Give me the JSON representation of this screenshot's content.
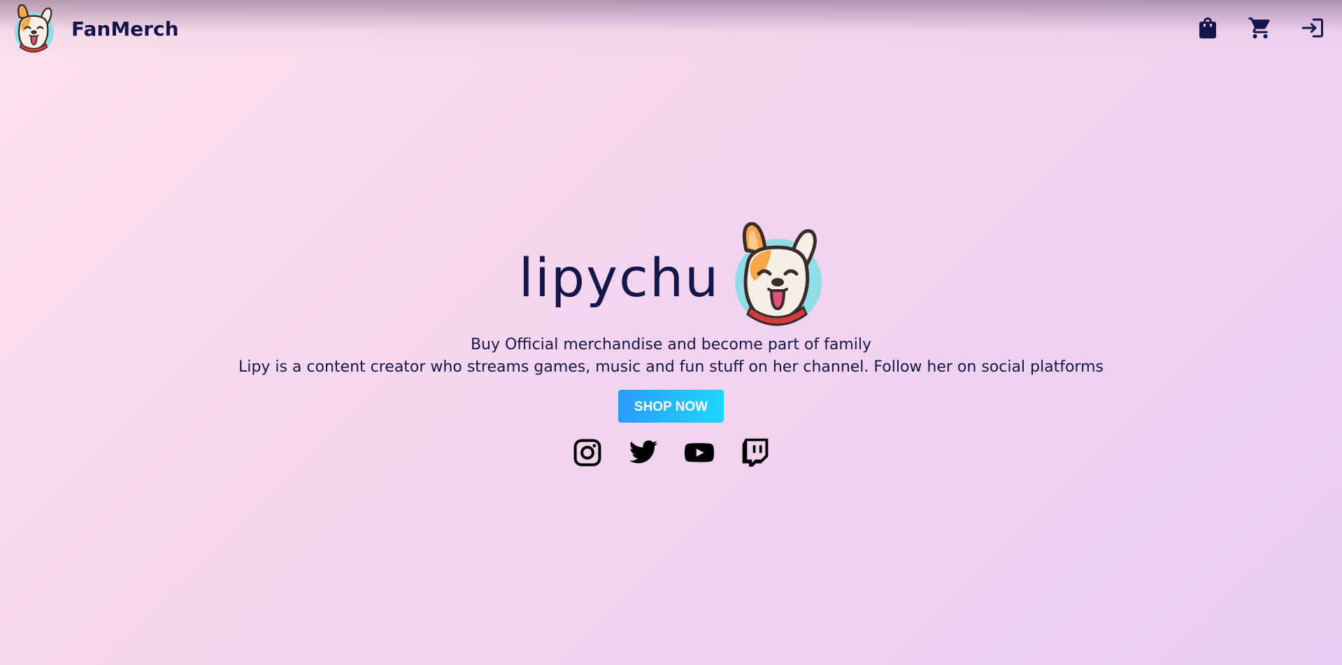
{
  "header": {
    "brand_name": "FanMerch",
    "logo_icon": "dog-mascot-icon",
    "actions": [
      {
        "name": "shopping-bag-icon",
        "label": "Shopping bag"
      },
      {
        "name": "cart-icon",
        "label": "Cart"
      },
      {
        "name": "login-icon",
        "label": "Login"
      }
    ]
  },
  "hero": {
    "title": "lipychu",
    "tagline": "Buy Official merchandise and become part of family",
    "description": "Lipy is a content creator who streams games, music and fun stuff on her channel. Follow her on social platforms",
    "cta_label": "SHOP NOW",
    "socials": [
      {
        "name": "instagram-icon"
      },
      {
        "name": "twitter-icon"
      },
      {
        "name": "youtube-icon"
      },
      {
        "name": "twitch-icon"
      }
    ]
  },
  "colors": {
    "text": "#14154a",
    "button_start": "#2a9cff",
    "button_end": "#1fd6ff",
    "background_start": "#fde0ec",
    "background_end": "#e9cdf2"
  }
}
